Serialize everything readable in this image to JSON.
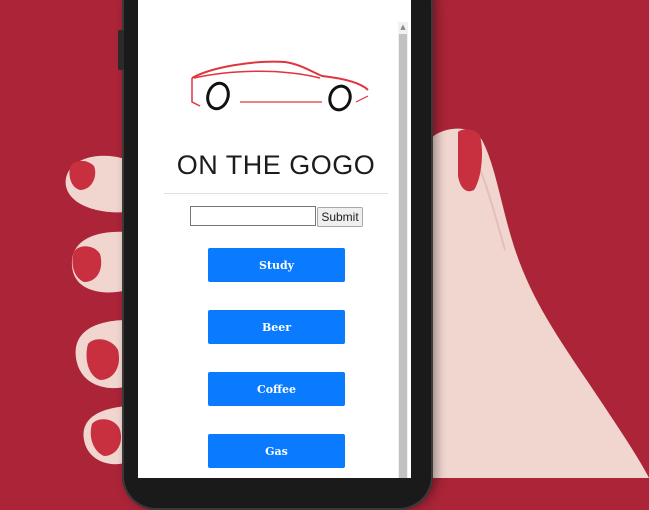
{
  "app": {
    "title": "ON THE GOGO",
    "logo_icon": "car-logo-icon"
  },
  "search": {
    "value": "",
    "placeholder": "",
    "submit_label": "Submit"
  },
  "categories": [
    {
      "label": "Study"
    },
    {
      "label": "Beer"
    },
    {
      "label": "Coffee"
    },
    {
      "label": "Gas"
    }
  ],
  "colors": {
    "background": "#ab2438",
    "button": "#0a7bff",
    "logo_accent": "#e0343f"
  }
}
